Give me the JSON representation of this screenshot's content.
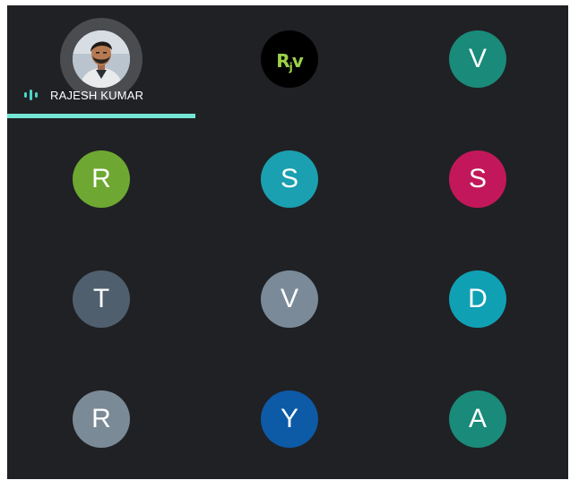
{
  "active_speaker": {
    "name": "RAJESH KUMAR",
    "icon": "speaking-indicator-icon",
    "accent_color": "#74e6d6"
  },
  "logo_tile": {
    "brand": "R",
    "sub": "j",
    "tail": "v",
    "background": "#000000"
  },
  "participants": [
    {
      "initial": "V",
      "color": "#1a8a7a"
    },
    {
      "initial": "R",
      "color": "#6ea832"
    },
    {
      "initial": "S",
      "color": "#1aa0b0"
    },
    {
      "initial": "S",
      "color": "#c2185b"
    },
    {
      "initial": "T",
      "color": "#4f5f6d"
    },
    {
      "initial": "V",
      "color": "#7a8a98"
    },
    {
      "initial": "D",
      "color": "#10a0b4"
    },
    {
      "initial": "R",
      "color": "#7b8a97"
    },
    {
      "initial": "Y",
      "color": "#0d5aa7"
    },
    {
      "initial": "A",
      "color": "#1a8a7a"
    }
  ],
  "grid_background": "#202124"
}
